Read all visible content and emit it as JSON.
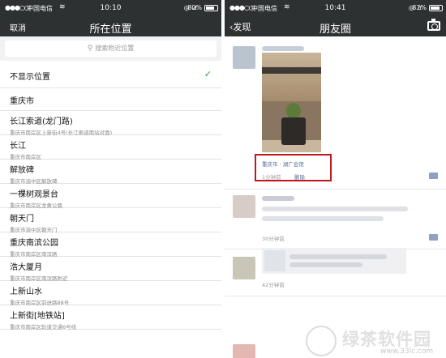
{
  "left_phone": {
    "status": {
      "signal": "●●●○○",
      "carrier": "中国电信",
      "time": "10:10",
      "battery": "80%",
      "battery_level": 0.8
    },
    "nav": {
      "cancel": "取消",
      "title": "所在位置"
    },
    "search": {
      "icon": "search-icon",
      "placeholder": "搜索附近位置"
    },
    "locations": [
      {
        "name": "不显示位置",
        "addr": "",
        "selected": true
      },
      {
        "name": "重庆市",
        "addr": ""
      },
      {
        "name": "长江索道(龙门路)",
        "addr": "重庆市南岸区上新街4号(长江索道南站对面)"
      },
      {
        "name": "长江",
        "addr": "重庆市南岸区"
      },
      {
        "name": "解放碑",
        "addr": "重庆市渝中区解放碑"
      },
      {
        "name": "一棵树观景台",
        "addr": "重庆市南岸区龙黄公路"
      },
      {
        "name": "朝天门",
        "addr": "重庆市渝中区朝天门"
      },
      {
        "name": "重庆南滨公园",
        "addr": "重庆市南岸区南滨路"
      },
      {
        "name": "浩大厦月",
        "addr": "重庆市南岸区南滨路附近"
      },
      {
        "name": "上新山水",
        "addr": "重庆市南岸区前进路88号"
      },
      {
        "name": "上新街[地铁站]",
        "addr": "重庆市南岸区轨道交通6号线"
      }
    ]
  },
  "right_phone": {
    "status": {
      "signal": "●●●○○",
      "carrier": "中国电信",
      "time": "10:41",
      "battery": "87%",
      "battery_level": 0.87
    },
    "nav": {
      "back": "‹发现",
      "title": "朋友圈",
      "camera": "camera-icon"
    },
    "posts": [
      {
        "location": "重庆市 · 湖广会馆",
        "time": "1分钟前",
        "delete": "删除"
      },
      {
        "time": "30分钟前"
      },
      {
        "time": "42分钟前"
      }
    ],
    "watermark": {
      "text": "绿茶软件园",
      "url": "www.33lc.com"
    }
  }
}
